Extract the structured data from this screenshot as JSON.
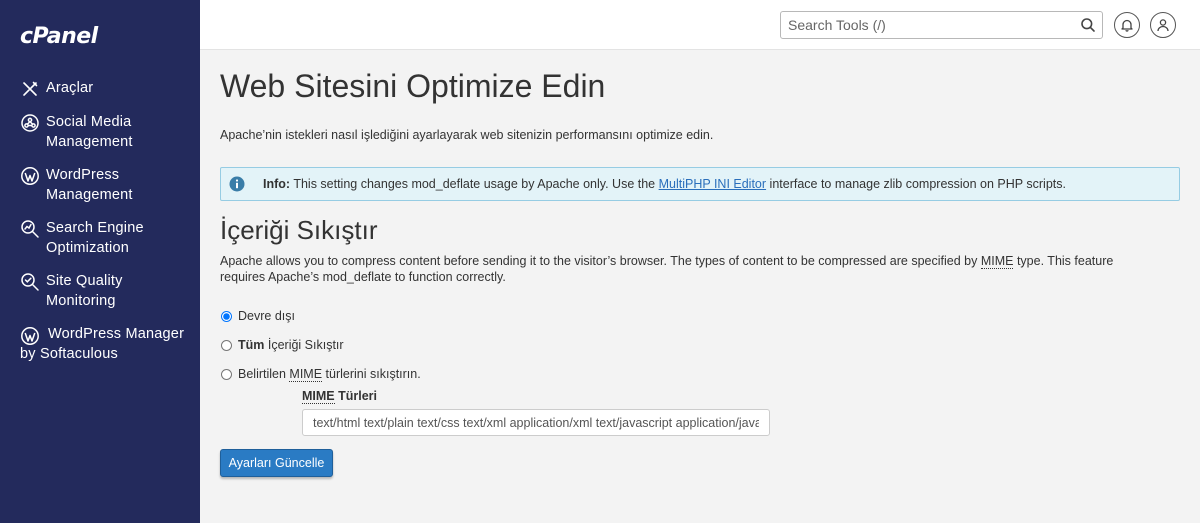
{
  "brand": {
    "logo_text": "cPanel"
  },
  "sidebar": {
    "items": [
      {
        "label": "Araçlar",
        "icon": "tools-icon"
      },
      {
        "label": "Social Media Management",
        "icon": "social-media-icon"
      },
      {
        "label": "WordPress Management",
        "icon": "wordpress-icon"
      },
      {
        "label": "Search Engine Optimization",
        "icon": "seo-icon"
      },
      {
        "label": "Site Quality Monitoring",
        "icon": "site-quality-icon"
      },
      {
        "label": "WordPress Manager by Softaculous",
        "icon": "wordpress-icon"
      }
    ]
  },
  "topbar": {
    "search_placeholder": "Search Tools (/)",
    "search_icon": "search-icon",
    "notification_icon": "bell-icon",
    "user_icon": "user-icon"
  },
  "main": {
    "title": "Web Sitesini Optimize Edin",
    "description": "Apache’nin istekleri nasıl işlediğini ayarlayarak web sitenizin performansını optimize edin.",
    "info": {
      "label": "Info:",
      "text_before": " This setting changes mod_deflate usage by Apache only. Use the ",
      "link_text": "MultiPHP INI Editor",
      "text_after": " interface to manage zlib compression on PHP scripts."
    },
    "section": {
      "title": "İçeriği Sıkıştır",
      "desc_before": "Apache allows you to compress content before sending it to the visitor’s browser. The types of content to be compressed are specified by ",
      "desc_abbr": "MIME",
      "desc_after": " type. This feature requires Apache’s mod_deflate to function correctly."
    },
    "options": {
      "disabled_label": "Devre dışı",
      "all_bold": "Tüm",
      "all_rest": " İçeriği Sıkıştır",
      "specific_before": "Belirtilen ",
      "specific_abbr": "MIME",
      "specific_after": " türlerini sıkıştırın.",
      "selected": "disabled"
    },
    "mime": {
      "label_abbr": "MIME",
      "label_rest": " Türleri",
      "value": "text/html text/plain text/css text/xml application/xml text/javascript application/javascript"
    },
    "update_button": "Ayarları Güncelle"
  },
  "colors": {
    "sidebar_bg": "#232a5c",
    "primary_button": "#2a7bc4",
    "info_bg": "#e3f3f8",
    "link": "#2a6ebb"
  }
}
